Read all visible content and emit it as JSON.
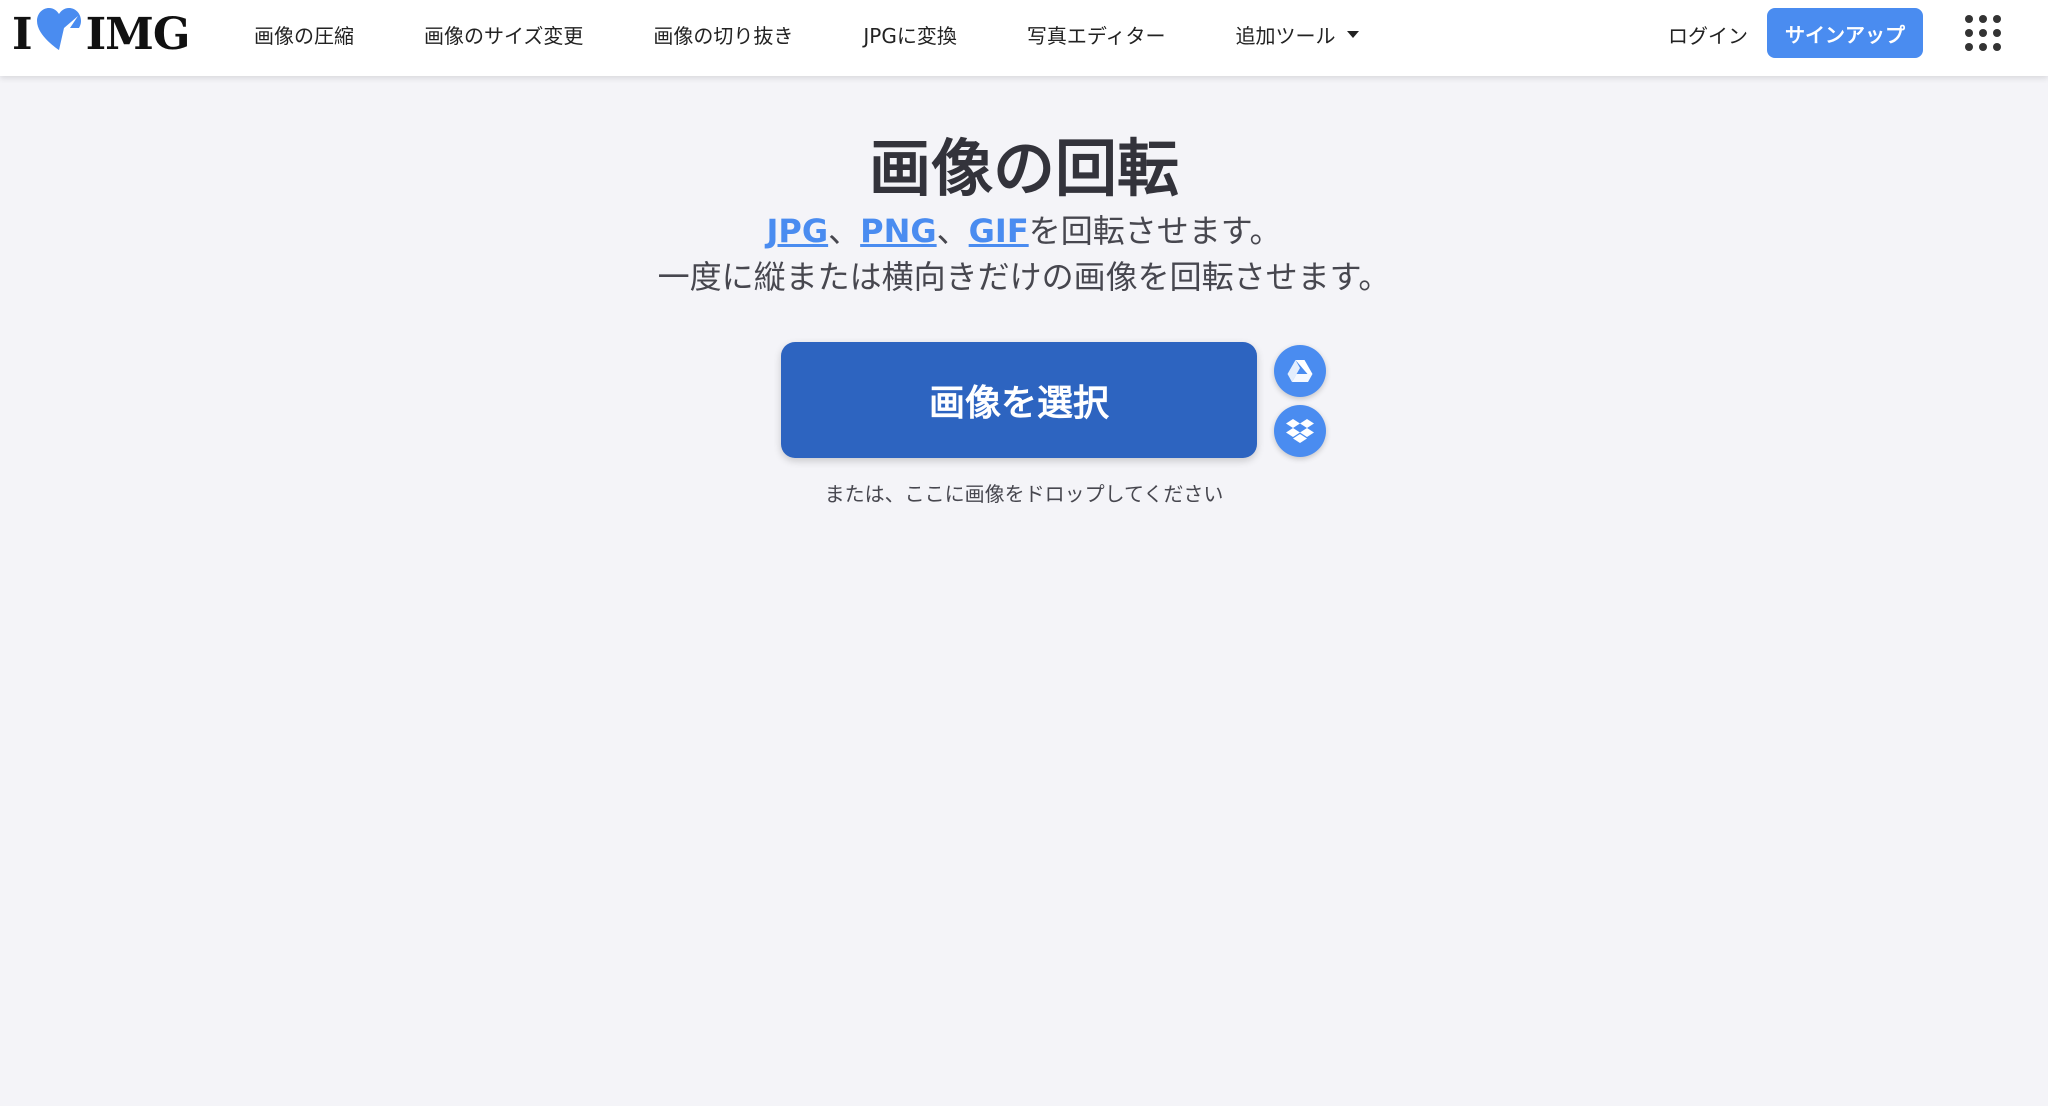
{
  "header": {
    "logo_left": "I",
    "logo_right": "IMG",
    "nav": [
      {
        "label": "画像の圧縮"
      },
      {
        "label": "画像のサイズ変更"
      },
      {
        "label": "画像の切り抜き"
      },
      {
        "label": "JPGに変換"
      },
      {
        "label": "写真エディター"
      },
      {
        "label": "追加ツール"
      }
    ],
    "login_label": "ログイン",
    "signup_label": "サインアップ",
    "apps_icon": "grid-icon"
  },
  "main": {
    "title": "画像の回転",
    "formats": [
      "JPG",
      "PNG",
      "GIF"
    ],
    "separator": "、",
    "subtitle_line1_suffix": "を回転させます。",
    "subtitle_line2": "一度に縦または横向きだけの画像を回転させます。",
    "select_button_label": "画像を選択",
    "drop_hint": "または、ここに画像をドロップしてください"
  },
  "icons": {
    "heart": "heart-icon",
    "google_drive": "google-drive-icon",
    "dropbox": "dropbox-icon"
  },
  "colors": {
    "accent": "#4a8cf0",
    "primary_button": "#2d64c0",
    "background": "#f4f4f8"
  }
}
